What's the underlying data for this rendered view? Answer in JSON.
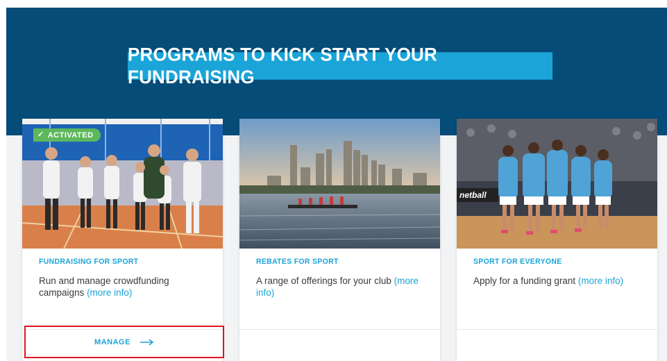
{
  "hero": {
    "title": "PROGRAMS TO KICK START YOUR FUNDRAISING",
    "background_color": "#054d78",
    "title_bg_color": "#1ba4d8"
  },
  "cards": [
    {
      "badge": "ACTIVATED",
      "category": "FUNDRAISING FOR SPORT",
      "description": "Run and manage crowdfunding campaigns",
      "more_info": "(more info)",
      "action": "MANAGE",
      "image": "fencing-team-photo"
    },
    {
      "category": "REBATES FOR SPORT",
      "description": "A range of offerings for your club",
      "more_info": "(more info)",
      "image": "rowing-city-skyline-photo"
    },
    {
      "category": "SPORT FOR EVERYONE",
      "description": "Apply for a funding grant",
      "more_info": "(more info)",
      "image": "netball-team-photo",
      "image_text": "netball"
    }
  ],
  "colors": {
    "accent": "#1ba4d8",
    "activated": "#5db85c",
    "highlight": "#e0141c"
  }
}
